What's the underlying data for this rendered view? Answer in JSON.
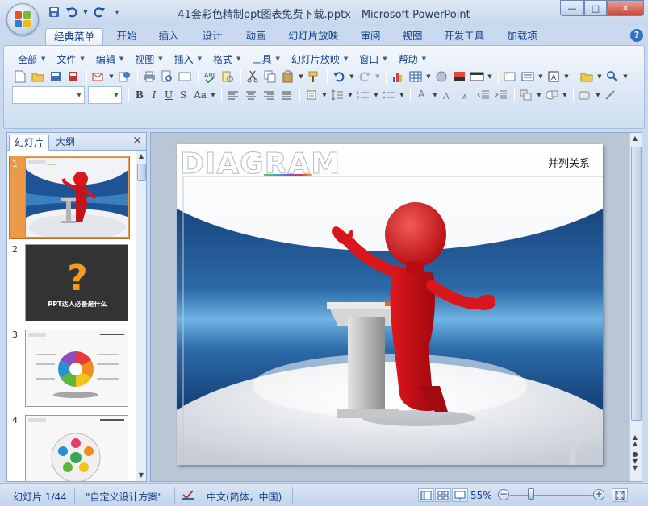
{
  "window": {
    "title": "41套彩色精制ppt图表免费下载.pptx - Microsoft PowerPoint",
    "controls": [
      "—",
      "□",
      "✕"
    ]
  },
  "quick_access": [
    "save-icon",
    "undo-icon",
    "redo-icon",
    "customize-icon"
  ],
  "ribbon_tabs": [
    {
      "label": "经典菜单",
      "active": true
    },
    {
      "label": "开始"
    },
    {
      "label": "插入"
    },
    {
      "label": "设计"
    },
    {
      "label": "动画"
    },
    {
      "label": "幻灯片放映"
    },
    {
      "label": "审阅"
    },
    {
      "label": "视图"
    },
    {
      "label": "开发工具"
    },
    {
      "label": "加载项"
    }
  ],
  "menus": [
    "全部",
    "文件",
    "编辑",
    "视图",
    "插入",
    "格式",
    "工具",
    "幻灯片放映",
    "窗口",
    "帮助"
  ],
  "format_buttons": [
    "B",
    "I",
    "U",
    "S",
    "Aa"
  ],
  "panel": {
    "tabs": [
      "幻灯片",
      "大纲"
    ],
    "slides": [
      {
        "num": "1",
        "selected": true
      },
      {
        "num": "2",
        "caption": "PPT达人必备是什么",
        "glyph": "?"
      },
      {
        "num": "3"
      },
      {
        "num": "4"
      }
    ]
  },
  "slide": {
    "logo_text": "DIAGRAM",
    "heading": "并列关系"
  },
  "status": {
    "slide_counter": "幻灯片 1/44",
    "theme": "\"自定义设计方案\"",
    "language": "中文(简体，中国)",
    "zoom": "55%",
    "zoom_value": 0.55
  },
  "colors": {
    "accent": "#15428b",
    "ribbon": "#dae6f5",
    "selected_thumb": "#ec9a4a",
    "figure_red": "#d8161b",
    "band_blue": "#17467f"
  }
}
